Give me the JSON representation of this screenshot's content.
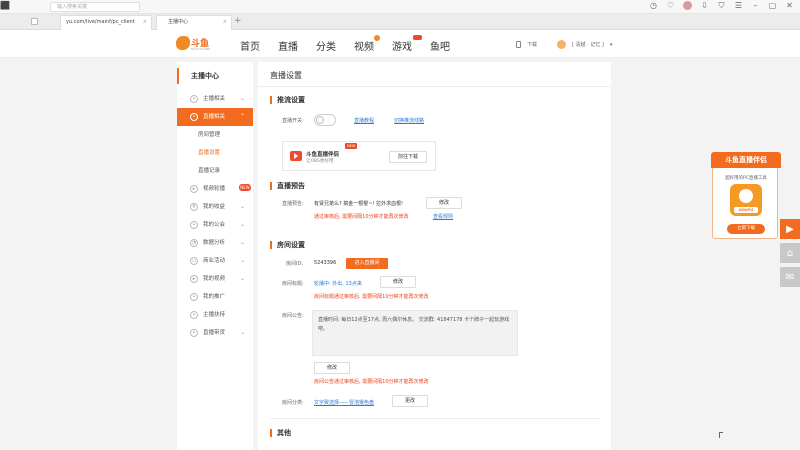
{
  "browser": {
    "search_placeholder": "输入搜索关键",
    "tabs": [
      {
        "label": "yu.com/live/mainf/pc_client"
      },
      {
        "label": "主播中心"
      }
    ],
    "new_tab": "+"
  },
  "header": {
    "brand_name": "斗鱼",
    "brand_url": "DOUYU.COM",
    "nav": [
      "首页",
      "直播",
      "分类",
      "视频",
      "游戏",
      "鱼吧"
    ],
    "download": "下载",
    "user": "[ 清越 · 记忆 ]"
  },
  "sidebar": {
    "title": "主播中心",
    "items": [
      {
        "label": "主播相关"
      },
      {
        "label": "直播相关"
      },
      {
        "label": "房间管理"
      },
      {
        "label": "直播设置"
      },
      {
        "label": "直播记录"
      },
      {
        "label": "视频轮播",
        "badge": "NEW"
      },
      {
        "label": "我的收益"
      },
      {
        "label": "我的公会"
      },
      {
        "label": "数据分析"
      },
      {
        "label": "商业活动"
      },
      {
        "label": "我的视频"
      },
      {
        "label": "我的推广"
      },
      {
        "label": "主播扶持"
      },
      {
        "label": "直播带货"
      }
    ]
  },
  "main": {
    "title": "直播设置",
    "push": {
      "heading": "推流设置",
      "switch_label": "直播开关:",
      "link_tutorial": "直播教程",
      "link_switch": "切换推流线路",
      "card_title": "斗鱼直播伴侣",
      "card_sub": "让OBS更好用",
      "card_new": "NEW",
      "card_btn": "前往下载"
    },
    "preview": {
      "heading": "直播预告",
      "label": "直播预告:",
      "text": "有贤兄弟么? 搞金一根棍~! 拉外求血根!",
      "edit": "修改",
      "warn": "通过审核后, 需要间隔10分钟才能再次修改",
      "rules": "查看规则"
    },
    "room": {
      "heading": "房间设置",
      "id_label": "房间ID:",
      "id_value": "5243396",
      "enter_btn": "进入直播间",
      "title_label": "房间标题:",
      "title_value": "轮播中: 外出, 13点来",
      "title_edit": "修改",
      "title_warn": "房间标题通过审核后, 需要间隔10分钟才能再次修改",
      "notice_label": "房间公告:",
      "notice_text": "直播时间: 每日12点至17点, 周六偶尔休息。 交流群: 41847178 卡个牌子一起玩游戏吧。",
      "notice_edit": "修改",
      "notice_warn": "房间公告通过审核后, 需要间隔10分钟才能再次修改",
      "category_label": "房间分类:",
      "category_value": "文字致选择——冒泡猴色盘",
      "category_edit": "更改"
    },
    "other": {
      "heading": "其他"
    }
  },
  "promo": {
    "title": "斗鱼直播伴侣",
    "subtitle": "超好用的PC直播工具",
    "app_tag": "DOUYU",
    "button": "立即下载"
  },
  "colors": {
    "accent": "#f26b1f",
    "link": "#2b7bd6",
    "warn": "#e8421b"
  }
}
